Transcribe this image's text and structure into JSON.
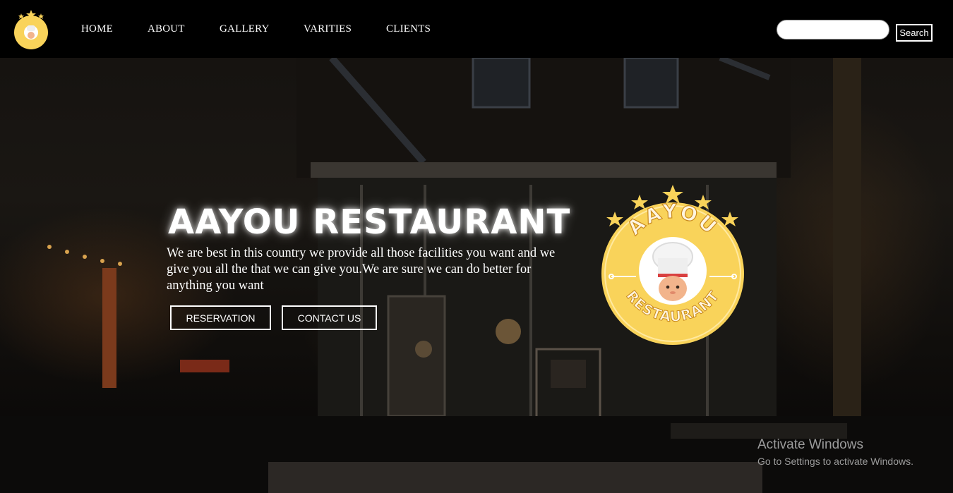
{
  "colors": {
    "accent": "#f9d35a",
    "nav_background": "#000000",
    "text": "#ffffff"
  },
  "nav": {
    "items": [
      {
        "label": "HOME"
      },
      {
        "label": "ABOUT"
      },
      {
        "label": "GALLERY"
      },
      {
        "label": "VARITIES"
      },
      {
        "label": "CLIENTS"
      }
    ]
  },
  "search": {
    "placeholder": "",
    "button_label": "Search"
  },
  "hero": {
    "title": "AAYOU RESTAURANT",
    "description": "We are best in this country we provide all those facilities you want and we give you all the that we can give you.We are sure we can do better for anything you want",
    "reservation_label": "RESERVATION",
    "contact_label": "CONTACT US"
  },
  "logo": {
    "top_text": "AAYOU",
    "bottom_text": "RESTAURANT",
    "icon": "chef-icon"
  },
  "watermark": {
    "title": "Activate Windows",
    "subtitle": "Go to Settings to activate Windows."
  }
}
